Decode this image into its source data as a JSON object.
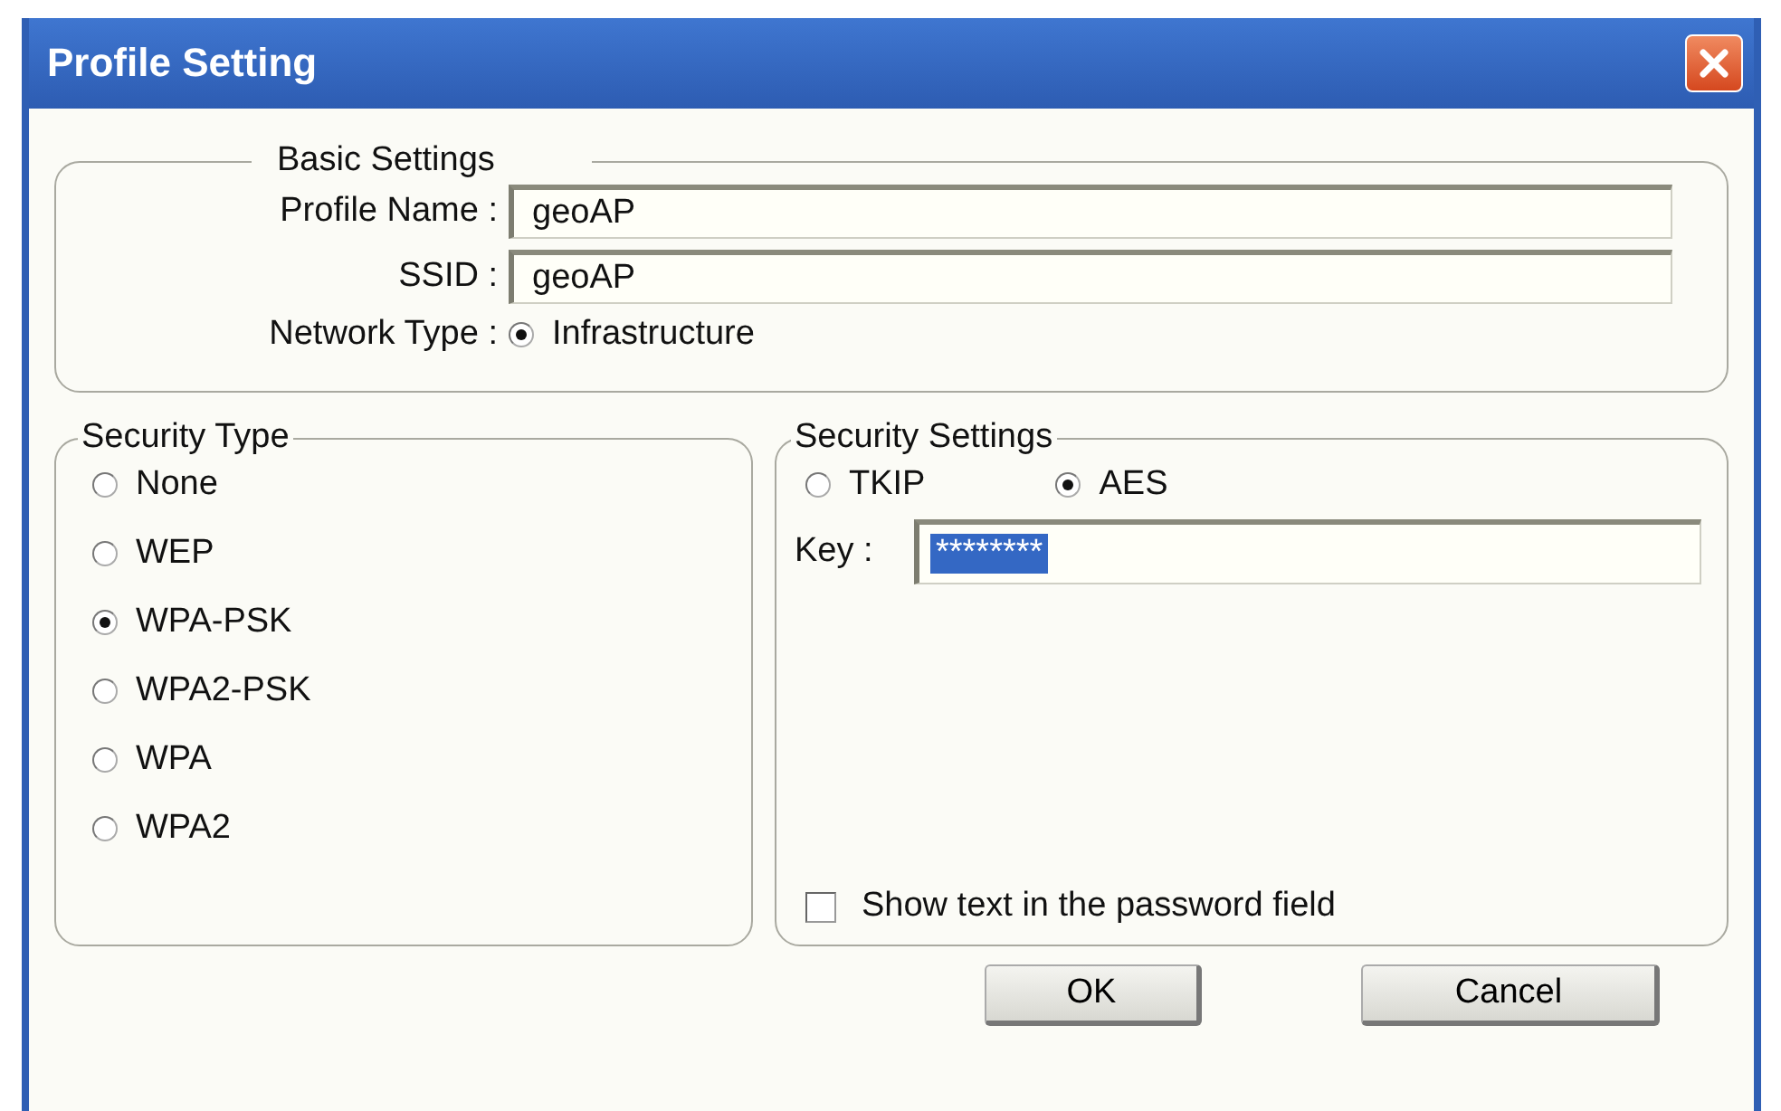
{
  "window": {
    "title": "Profile Setting"
  },
  "basic_settings": {
    "title": "Basic Settings",
    "fields": [
      {
        "label": "Profile Name :",
        "value": "geoAP"
      },
      {
        "label": "SSID :",
        "value": "geoAP"
      }
    ],
    "network_type": {
      "label": "Network Type :",
      "options": [
        {
          "label": "Infrastructure",
          "selected": true
        }
      ]
    }
  },
  "security_type": {
    "title": "Security Type",
    "options": [
      {
        "label": "None",
        "selected": false
      },
      {
        "label": "WEP",
        "selected": false
      },
      {
        "label": "WPA-PSK",
        "selected": true
      },
      {
        "label": "WPA2-PSK",
        "selected": false
      },
      {
        "label": "WPA",
        "selected": false
      },
      {
        "label": "WPA2",
        "selected": false
      }
    ]
  },
  "security_settings": {
    "title": "Security Settings",
    "encryption": [
      {
        "label": "TKIP",
        "selected": false
      },
      {
        "label": "AES",
        "selected": true
      }
    ],
    "key": {
      "label": "Key :",
      "value": "********",
      "text_selected": true
    },
    "show_text": {
      "label": "Show text in the password field",
      "checked": false
    }
  },
  "buttons": [
    "OK",
    "Cancel"
  ]
}
